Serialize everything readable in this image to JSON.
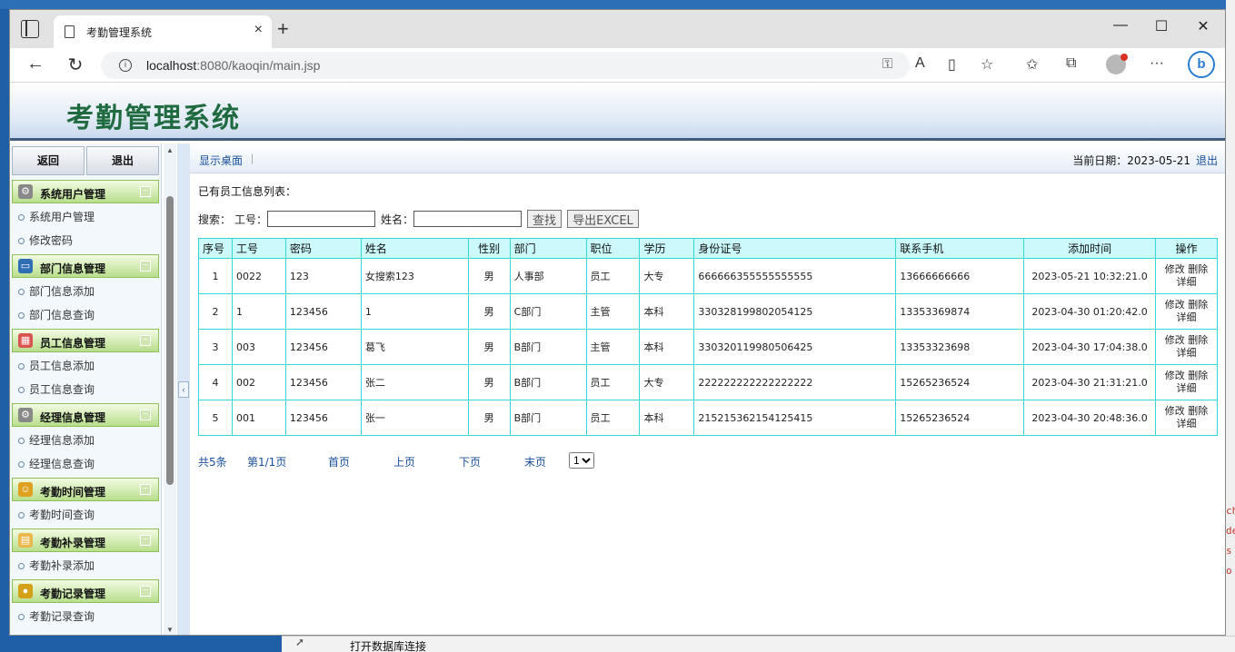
{
  "browser": {
    "tab_title": "考勤管理系统",
    "tab_close": "×",
    "new_tab": "+",
    "url_host": "localhost",
    "url_path": ":8080/kaoqin/main.jsp",
    "win_min": "—",
    "win_max": "☐",
    "win_close": "✕"
  },
  "page": {
    "title": "考勤管理系统"
  },
  "leftmenu": {
    "back": "返回",
    "exit": "退出",
    "groups": [
      {
        "label": "系统用户管理",
        "icon": "gear-icon",
        "items": [
          "系统用户管理",
          "修改密码"
        ]
      },
      {
        "label": "部门信息管理",
        "icon": "monitor-icon",
        "items": [
          "部门信息添加",
          "部门信息查询"
        ]
      },
      {
        "label": "员工信息管理",
        "icon": "table-icon",
        "items": [
          "员工信息添加",
          "员工信息查询"
        ]
      },
      {
        "label": "经理信息管理",
        "icon": "gear-icon",
        "items": [
          "经理信息添加",
          "经理信息查询"
        ]
      },
      {
        "label": "考勤时间管理",
        "icon": "person-icon",
        "items": [
          "考勤时间查询"
        ]
      },
      {
        "label": "考勤补录管理",
        "icon": "folder-icon",
        "items": [
          "考勤补录添加"
        ]
      },
      {
        "label": "考勤记录管理",
        "icon": "coin-icon",
        "items": [
          "考勤记录查询"
        ]
      }
    ]
  },
  "content": {
    "crumb": "显示桌面",
    "date_label": "当前日期：2023-05-21",
    "logout": "退出",
    "list_title": "已有员工信息列表：",
    "search": {
      "label": "搜索：",
      "id_label": "工号：",
      "name_label": "姓名：",
      "id_value": "",
      "name_value": "",
      "find_btn": "查找",
      "export_btn": "导出EXCEL"
    },
    "table": {
      "headers": [
        "序号",
        "工号",
        "密码",
        "姓名",
        "性别",
        "部门",
        "职位",
        "学历",
        "身份证号",
        "联系手机",
        "添加时间",
        "操作"
      ],
      "rows": [
        [
          "1",
          "0022",
          "123",
          "女搜索123",
          "男",
          "人事部",
          "员工",
          "大专",
          "666666355555555555",
          "13666666666",
          "2023-05-21 10:32:21.0"
        ],
        [
          "2",
          "1",
          "123456",
          "1",
          "男",
          "C部门",
          "主管",
          "本科",
          "330328199802054125",
          "13353369874",
          "2023-04-30 01:20:42.0"
        ],
        [
          "3",
          "003",
          "123456",
          "葛飞",
          "男",
          "B部门",
          "主管",
          "本科",
          "330320119980506425",
          "13353323698",
          "2023-04-30 17:04:38.0"
        ],
        [
          "4",
          "002",
          "123456",
          "张二",
          "男",
          "B部门",
          "员工",
          "大专",
          "222222222222222222",
          "15265236524",
          "2023-04-30 21:31:21.0"
        ],
        [
          "5",
          "001",
          "123456",
          "张一",
          "男",
          "B部门",
          "员工",
          "本科",
          "215215362154125415",
          "15265236524",
          "2023-04-30 20:48:36.0"
        ]
      ],
      "op_edit": "修改",
      "op_delete": "删除",
      "op_detail": "详细"
    },
    "pager": {
      "total": "共5条",
      "page": "第1/1页",
      "first": "首页",
      "prev": "上页",
      "next": "下页",
      "last": "末页",
      "select_value": "1"
    }
  },
  "desktop": {
    "bottom_text": "打开数据库连接",
    "right_chars": [
      "ch",
      "de",
      "s",
      "o"
    ]
  }
}
